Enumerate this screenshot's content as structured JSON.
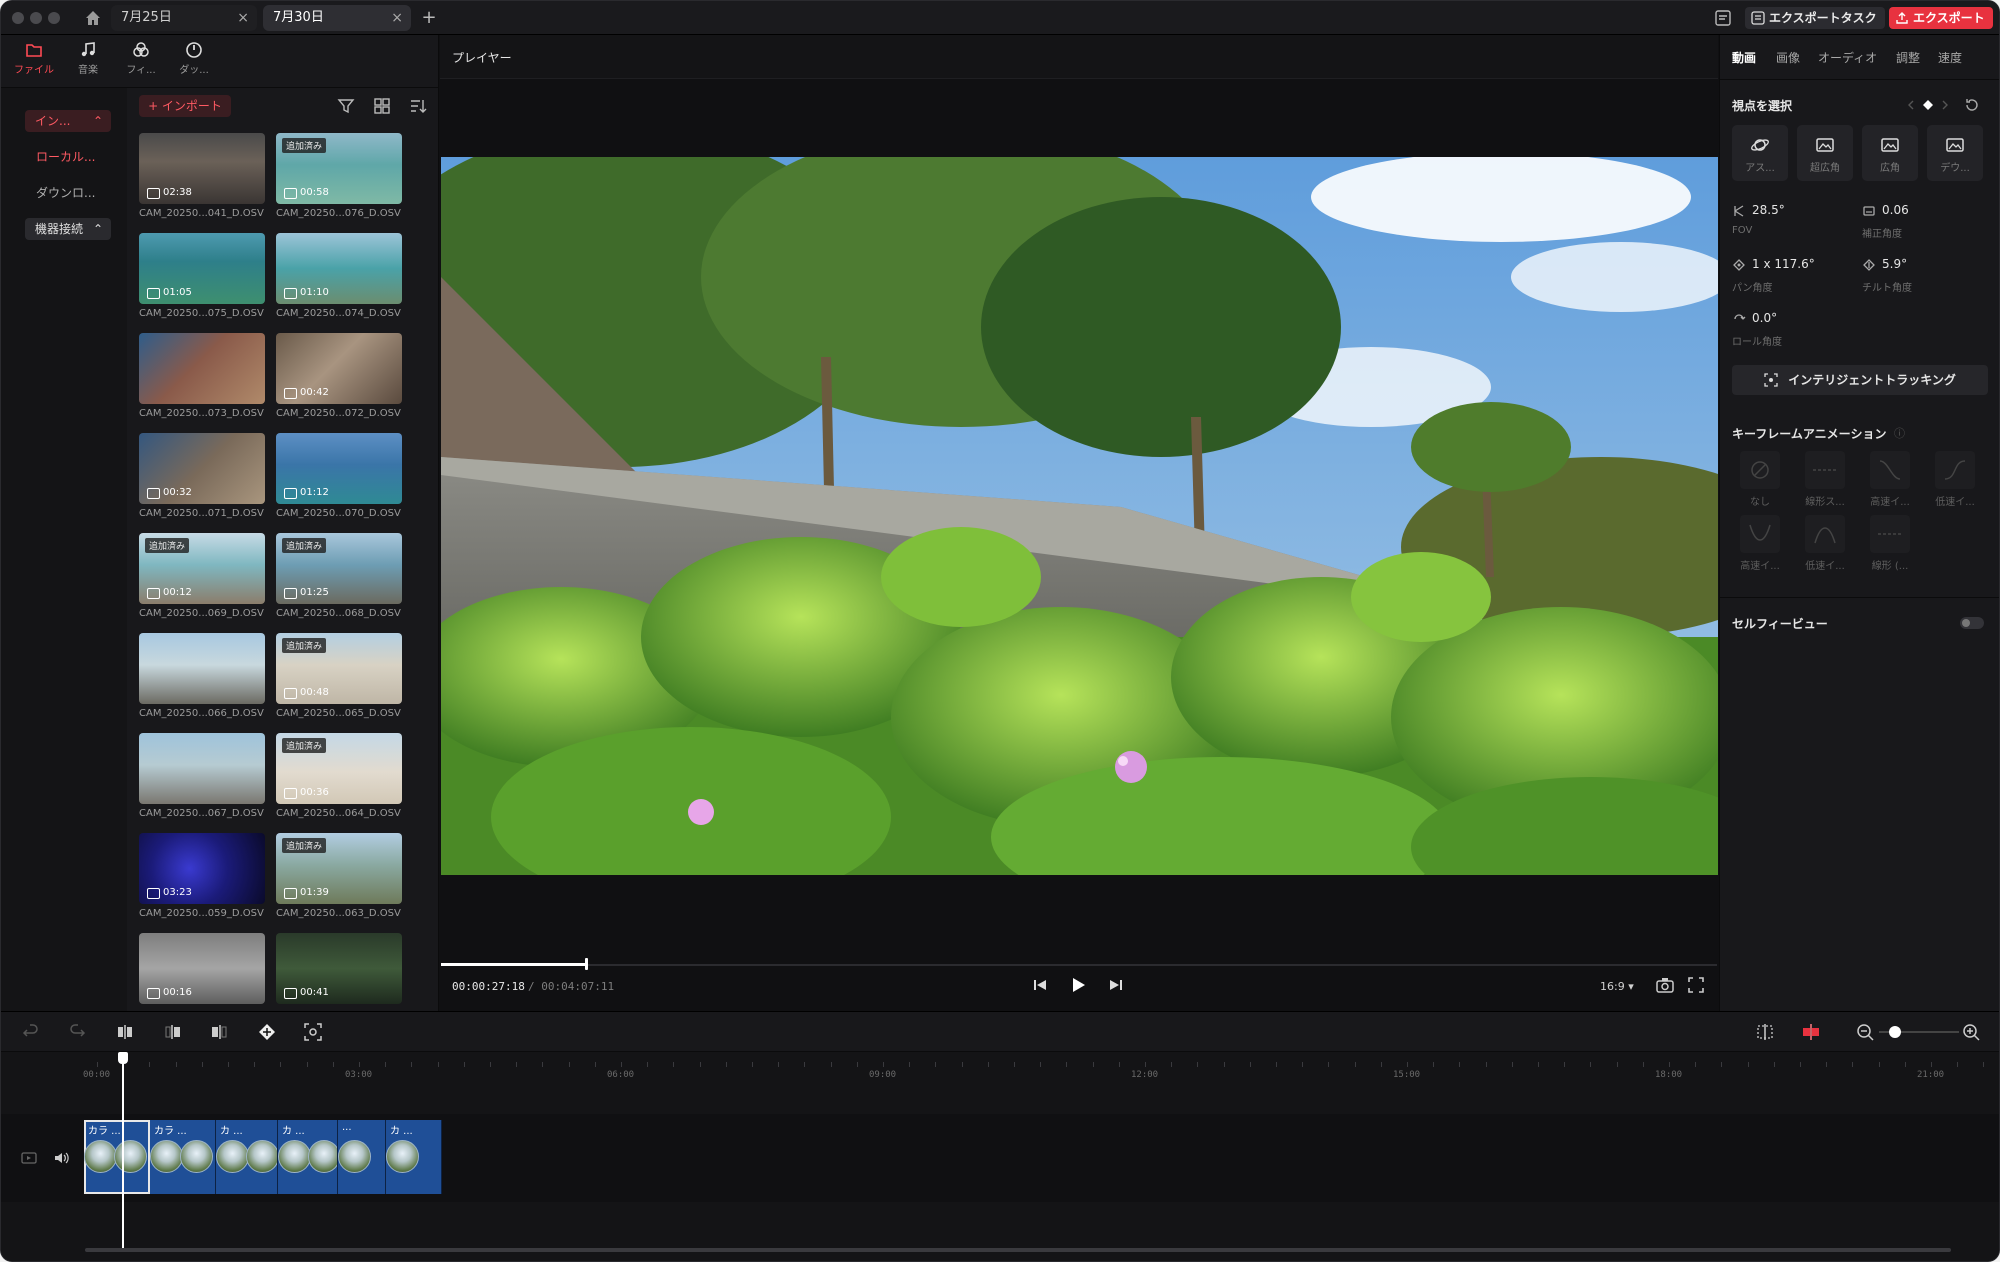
{
  "titlebar": {
    "tabs": [
      {
        "label": "7月25日"
      },
      {
        "label": "7月30日"
      }
    ],
    "export_task_label": "エクスポートタスク",
    "export_label": "エクスポート",
    "accent": "#e8323f"
  },
  "left_panel": {
    "categories": [
      {
        "label": "ファイル",
        "icon": "folder-icon",
        "active": true
      },
      {
        "label": "音楽",
        "icon": "music-note-icon",
        "active": false
      },
      {
        "label": "フィ...",
        "icon": "filter-icon",
        "active": false
      },
      {
        "label": "ダッ...",
        "icon": "clock-icon",
        "active": false
      }
    ],
    "nav": {
      "import_label": "イン...",
      "local_label": "ローカル...",
      "download_label": "ダウンロ...",
      "device_label": "機器接続"
    },
    "import_button": "+ インポート",
    "added_badge": "追加済み",
    "media": [
      {
        "name": "CAM_20250...041_D.OSV",
        "duration": "02:38",
        "added": false
      },
      {
        "name": "CAM_20250...076_D.OSV",
        "duration": "00:58",
        "added": true
      },
      {
        "name": "CAM_20250...075_D.OSV",
        "duration": "01:05",
        "added": false
      },
      {
        "name": "CAM_20250...074_D.OSV",
        "duration": "01:10",
        "added": false
      },
      {
        "name": "CAM_20250...073_D.OSV",
        "duration": "",
        "added": false
      },
      {
        "name": "CAM_20250...072_D.OSV",
        "duration": "00:42",
        "added": false
      },
      {
        "name": "CAM_20250...071_D.OSV",
        "duration": "00:32",
        "added": false
      },
      {
        "name": "CAM_20250...070_D.OSV",
        "duration": "01:12",
        "added": false
      },
      {
        "name": "CAM_20250...069_D.OSV",
        "duration": "00:12",
        "added": true
      },
      {
        "name": "CAM_20250...068_D.OSV",
        "duration": "01:25",
        "added": true
      },
      {
        "name": "CAM_20250...066_D.OSV",
        "duration": "",
        "added": false
      },
      {
        "name": "CAM_20250...065_D.OSV",
        "duration": "00:48",
        "added": true
      },
      {
        "name": "CAM_20250...067_D.OSV",
        "duration": "",
        "added": false
      },
      {
        "name": "CAM_20250...064_D.OSV",
        "duration": "00:36",
        "added": true
      },
      {
        "name": "CAM_20250...059_D.OSV",
        "duration": "03:23",
        "added": false
      },
      {
        "name": "CAM_20250...063_D.OSV",
        "duration": "01:39",
        "added": true
      },
      {
        "name": "",
        "duration": "00:16",
        "added": false
      },
      {
        "name": "",
        "duration": "00:41",
        "added": false
      }
    ]
  },
  "player": {
    "title": "プレイヤー",
    "current_time": "00:00:27:18",
    "total_time": "/ 00:04:07:11",
    "aspect": "16:9 ▾",
    "progress_fraction": 0.11
  },
  "right_panel": {
    "tabs": [
      "動画",
      "画像",
      "オーディオ",
      "調整",
      "速度"
    ],
    "viewpoint_title": "視点を選択",
    "view_modes": [
      "アス...",
      "超広角",
      "広角",
      "デウ..."
    ],
    "params": [
      {
        "value": "28.5°",
        "label": "FOV",
        "icon": "fov-icon"
      },
      {
        "value": "0.06",
        "label": "補正角度",
        "icon": "distortion-icon"
      },
      {
        "value": "1 x 117.6°",
        "label": "パン角度",
        "icon": "pan-icon"
      },
      {
        "value": "5.9°",
        "label": "チルト角度",
        "icon": "tilt-icon"
      },
      {
        "value": "0.0°",
        "label": "ロール角度",
        "icon": "roll-icon"
      }
    ],
    "tracking_label": "インテリジェントトラッキング",
    "keyframe_title": "キーフレームアニメーション",
    "keyframes": [
      "なし",
      "線形ス...",
      "高速イ...",
      "低速イ...",
      "高速イ...",
      "低速イ...",
      "線形 (..."
    ],
    "selfie_label": "セルフィービュー"
  },
  "timeline": {
    "ruler_labels": [
      "00:00",
      "03:00",
      "06:00",
      "09:00",
      "12:00",
      "15:00",
      "18:00",
      "21:00"
    ],
    "clips": [
      {
        "label": "カラ ..."
      },
      {
        "label": "カラ ..."
      },
      {
        "label": "カ ..."
      },
      {
        "label": "カ ..."
      },
      {
        "label": "..."
      },
      {
        "label": "カ ..."
      }
    ]
  }
}
